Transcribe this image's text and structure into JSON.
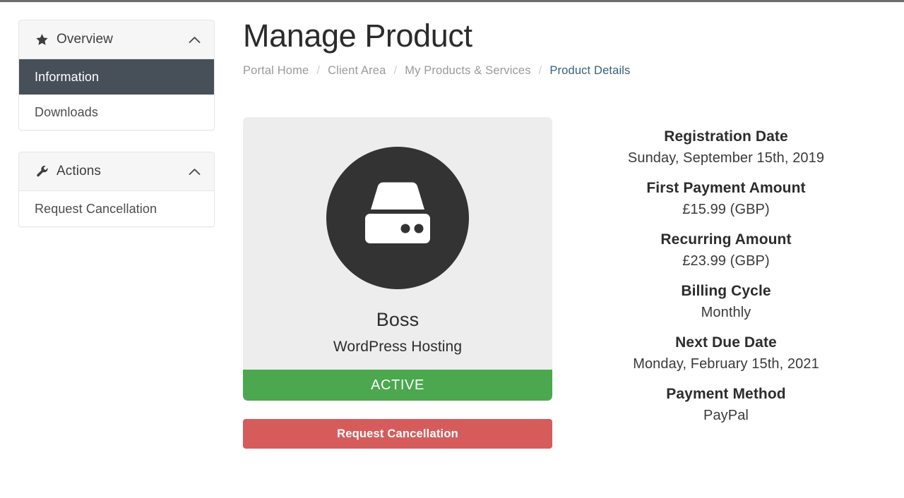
{
  "header": {
    "title": "Manage Product"
  },
  "breadcrumb": {
    "separator": "/",
    "items": [
      {
        "label": "Portal Home",
        "current": false
      },
      {
        "label": "Client Area",
        "current": false
      },
      {
        "label": "My Products & Services",
        "current": false
      },
      {
        "label": "Product Details",
        "current": true
      }
    ]
  },
  "sidebar": {
    "panels": [
      {
        "title": "Overview",
        "icon": "star-icon",
        "collapse_icon": "chevron-up-icon",
        "items": [
          {
            "label": "Information",
            "active": true
          },
          {
            "label": "Downloads",
            "active": false
          }
        ]
      },
      {
        "title": "Actions",
        "icon": "wrench-icon",
        "collapse_icon": "chevron-up-icon",
        "items": [
          {
            "label": "Request Cancellation",
            "active": false
          }
        ]
      }
    ]
  },
  "product": {
    "icon": "hard-drive-icon",
    "name": "Boss",
    "group": "WordPress Hosting",
    "status": "ACTIVE",
    "status_color": "#4ba84e",
    "cancel_button_label": "Request Cancellation",
    "cancel_button_color": "#d65c5c"
  },
  "details": [
    {
      "label": "Registration Date",
      "value": "Sunday, September 15th, 2019"
    },
    {
      "label": "First Payment Amount",
      "value": "£15.99 (GBP)"
    },
    {
      "label": "Recurring Amount",
      "value": "£23.99 (GBP)"
    },
    {
      "label": "Billing Cycle",
      "value": "Monthly"
    },
    {
      "label": "Next Due Date",
      "value": "Monday, February 15th, 2021"
    },
    {
      "label": "Payment Method",
      "value": "PayPal"
    }
  ],
  "colors": {
    "active_nav": "#474f58",
    "breadcrumb_link": "#35617f",
    "card_bg": "#ededed",
    "icon_circle": "#333333"
  }
}
